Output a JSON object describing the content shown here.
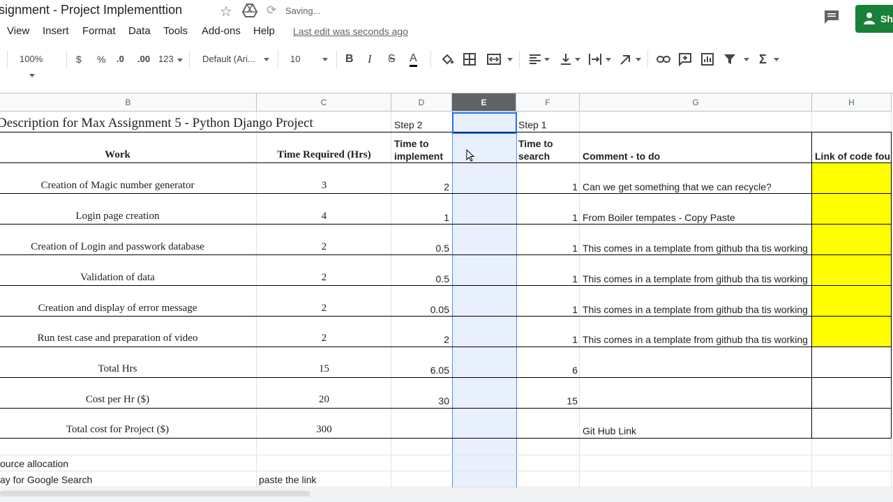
{
  "title_bar": {
    "doc_title": "signment - Project Implementtion",
    "saving": "Saving...",
    "share_label": "Sh"
  },
  "menu": {
    "items": [
      "View",
      "Insert",
      "Format",
      "Data",
      "Tools",
      "Add-ons",
      "Help"
    ],
    "last_edit": "Last edit was seconds ago"
  },
  "toolbar": {
    "zoom": "100%",
    "currency": "$",
    "percent": "%",
    "dec_decrease": ".0",
    "dec_increase": ".00",
    "more_formats": "123",
    "font": "Default (Ari...",
    "font_size": "10",
    "icons": [
      "bold-icon",
      "italic-icon",
      "strikethrough-icon",
      "text-color-icon",
      "fill-color-icon",
      "borders-icon",
      "merge-icon",
      "align-icon",
      "valign-icon",
      "wrap-icon",
      "rotate-icon",
      "link-icon",
      "comment-icon",
      "chart-icon",
      "filter-icon",
      "functions-icon"
    ],
    "accent": "#188038"
  },
  "columns": [
    "B",
    "C",
    "D",
    "E",
    "F",
    "G",
    "H"
  ],
  "selected_column": "E",
  "sheet": {
    "title": "Description for Max Assignment 5 - Python Django Project",
    "step2": "Step 2",
    "step1": "Step 1",
    "headers": {
      "work": "Work",
      "time_required": "Time Required (Hrs)",
      "time_implement_1": "Time to",
      "time_implement_2": "implement",
      "time_search_1": "Time to",
      "time_search_2": "search",
      "comment": "Comment - to do",
      "link": "Link of code fou"
    },
    "rows": [
      {
        "work": "Creation of Magic number generator",
        "hrs": "3",
        "impl": "2",
        "search": "1",
        "comment": "Can we get something that we can recycle?"
      },
      {
        "work": "Login page creation",
        "hrs": "4",
        "impl": "1",
        "search": "1",
        "comment": "From Boiler tempates - Copy Paste"
      },
      {
        "work": "Creation of Login and passwork database",
        "hrs": "2",
        "impl": "0.5",
        "search": "1",
        "comment": "This comes in a template from github tha tis working"
      },
      {
        "work": "Validation of data",
        "hrs": "2",
        "impl": "0.5",
        "search": "1",
        "comment": "This comes in a template from github tha tis working"
      },
      {
        "work": "Creation and display of error message",
        "hrs": "2",
        "impl": "0.05",
        "search": "1",
        "comment": "This comes in a template from github tha tis working"
      },
      {
        "work": "Run test case and preparation of video",
        "hrs": "2",
        "impl": "2",
        "search": "1",
        "comment": "This comes in a template from github tha tis working"
      }
    ],
    "totals": [
      {
        "label": "Total Hrs",
        "hrs": "15",
        "impl": "6.05",
        "search": "6",
        "comment": ""
      },
      {
        "label": "Cost per Hr ($)",
        "hrs": "20",
        "impl": "30",
        "search": "15",
        "comment": ""
      },
      {
        "label": "Total cost for Project ($)",
        "hrs": "300",
        "impl": "",
        "search": "",
        "comment": "Git Hub Link"
      }
    ],
    "footer1": "ource allocation",
    "footer2": "ay for Google Search",
    "footer2_c": "paste the link"
  }
}
